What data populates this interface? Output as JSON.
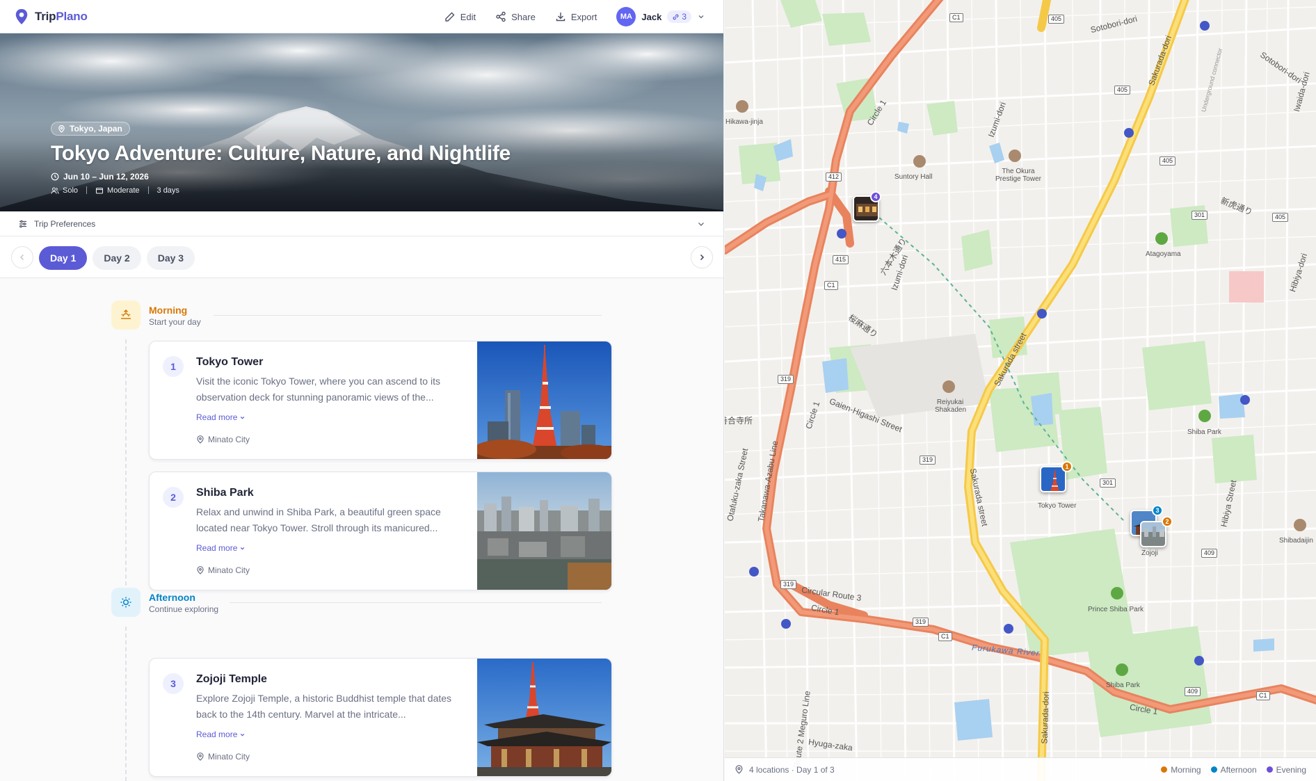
{
  "app": {
    "name_part1": "Trip",
    "name_part2": "Plano"
  },
  "toolbar": {
    "edit": "Edit",
    "share": "Share",
    "export": "Export"
  },
  "user": {
    "initials": "MA",
    "name": "Jack",
    "collaborators": "3"
  },
  "trip": {
    "location": "Tokyo, Japan",
    "title": "Tokyo Adventure: Culture, Nature, and Nightlife",
    "dates": "Jun 10 – Jun 12, 2026",
    "travelers": "Solo",
    "pace": "Moderate",
    "duration": "3 days"
  },
  "preferences": {
    "label": "Trip Preferences"
  },
  "days": {
    "tabs": [
      "Day 1",
      "Day 2",
      "Day 3"
    ],
    "active": 0
  },
  "periods": {
    "morning": {
      "name": "Morning",
      "sub": "Start your day",
      "color": "#d97706"
    },
    "afternoon": {
      "name": "Afternoon",
      "sub": "Continue exploring",
      "color": "#0284c7"
    }
  },
  "activities": [
    {
      "num": "1",
      "title": "Tokyo Tower",
      "desc": "Visit the iconic Tokyo Tower, where you can ascend to its observation deck for stunning panoramic views of the...",
      "more": "Read more",
      "place": "Minato City"
    },
    {
      "num": "2",
      "title": "Shiba Park",
      "desc": "Relax and unwind in Shiba Park, a beautiful green space located near Tokyo Tower. Stroll through its manicured...",
      "more": "Read more",
      "place": "Minato City"
    },
    {
      "num": "3",
      "title": "Zojoji Temple",
      "desc": "Explore Zojoji Temple, a historic Buddhist temple that dates back to the 14th century. Marvel at the intricate...",
      "more": "Read more",
      "place": "Minato City"
    }
  ],
  "map": {
    "labels": {
      "hikawa": "Hikawa-jinja",
      "suntory": "Suntory Hall",
      "okura": "The Okura Prestige Tower",
      "atagoyama": "Atagoyama",
      "reiyukai": "Reiyukai Shakaden",
      "shibapark_ne": "Shiba Park",
      "tokyotower": "Tokyo Tower",
      "zojoji": "Zojoji",
      "princeshiba": "Prince Shiba Park",
      "shibapark_s": "Shiba Park",
      "shibadaijin": "Shibadaijin",
      "sotobori": "Sotobori-dori",
      "sotobori2": "Sotobori-dori",
      "sakurada": "Sakurada-dori",
      "sakurada_st": "Sakurada street",
      "sakurada_st2": "Sakurada street",
      "sakurada_dori_s": "Sakurada-dori",
      "izumi": "Izumi-dori",
      "izumi2": "Izumi-dori",
      "iwaida": "Iwaida-dori",
      "circle1": "Circle 1",
      "circle1b": "Circle 1",
      "circle1c": "Circle 1",
      "circle1d": "Circle 1",
      "circular3": "Circular Route 3",
      "gaien": "Gaien-Higashi Street",
      "takanawa": "Takanawa-Azabu Line",
      "otafukuzaka": "Otafuku-zaka Street",
      "furukawa": "Furukawa River",
      "hyuga": "Hyuga-zaka",
      "hibiya": "Hibiya Street",
      "hibiya_dori": "Hibiya-dori",
      "meguro": "Route 2 Meguro Line",
      "underground": "Underground connector",
      "shintora": "新虎通り",
      "sakurazaka": "桜麻通り",
      "azabu_st": "六本木通り",
      "yogenji": "善合寺所"
    },
    "shields": [
      "C1",
      "405",
      "405",
      "405",
      "412",
      "415",
      "C1",
      "301",
      "405",
      "319",
      "319",
      "301",
      "409",
      "319",
      "319",
      "C1",
      "409",
      "C1"
    ],
    "markers": [
      "1",
      "2",
      "3",
      "4"
    ],
    "footer": "4 locations · Day 1 of 3",
    "legend": [
      {
        "label": "Morning",
        "color": "#d97706"
      },
      {
        "label": "Afternoon",
        "color": "#0284c7"
      },
      {
        "label": "Evening",
        "color": "#6d4fd8"
      }
    ]
  }
}
